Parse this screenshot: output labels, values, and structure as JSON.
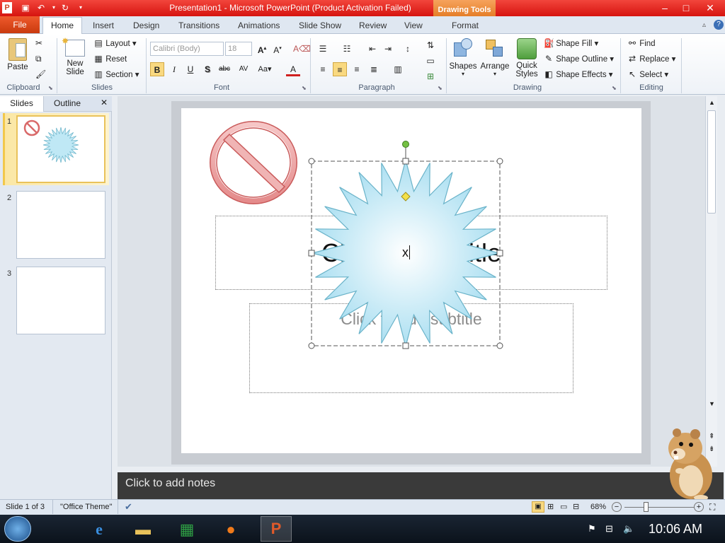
{
  "window": {
    "title": "Presentation1  -  Microsoft PowerPoint (Product Activation Failed)",
    "context_tab": "Drawing Tools"
  },
  "tabs": [
    "File",
    "Home",
    "Insert",
    "Design",
    "Transitions",
    "Animations",
    "Slide Show",
    "Review",
    "View",
    "Format"
  ],
  "ribbon": {
    "clipboard": {
      "paste": "Paste",
      "label": "Clipboard"
    },
    "slides": {
      "new_slide": "New Slide",
      "layout": "Layout",
      "reset": "Reset",
      "section": "Section",
      "label": "Slides"
    },
    "font": {
      "font_name": "Calibri (Body)",
      "font_size": "18",
      "label": "Font"
    },
    "paragraph": {
      "label": "Paragraph"
    },
    "drawing": {
      "shapes": "Shapes",
      "arrange": "Arrange",
      "quick_styles": "Quick Styles",
      "shape_fill": "Shape Fill",
      "shape_outline": "Shape Outline",
      "shape_effects": "Shape Effects",
      "label": "Drawing"
    },
    "editing": {
      "find": "Find",
      "replace": "Replace",
      "select": "Select",
      "label": "Editing"
    }
  },
  "pane": {
    "tab_slides": "Slides",
    "tab_outline": "Outline",
    "slide_numbers": [
      "1",
      "2",
      "3"
    ]
  },
  "slide": {
    "title_placeholder": "Click to add title",
    "subtitle_placeholder": "Click to add subtitle",
    "typed_text": "x"
  },
  "notes_placeholder": "Click to add notes",
  "status": {
    "slide_info": "Slide 1 of 3",
    "theme": "\"Office Theme\"",
    "zoom": "68%"
  },
  "taskbar": {
    "clock": "10:06 AM"
  },
  "colors": {
    "title_bar": "#d6140f",
    "context_tab": "#e2781f",
    "starburst_fill": "#bfe8f5",
    "starburst_stroke": "#6ab3c9",
    "no_symbol": "#e37f7f"
  }
}
